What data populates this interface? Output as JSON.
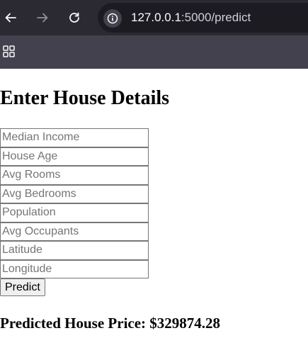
{
  "browser": {
    "url_host": "127.0.0.1",
    "url_rest": ":5000/predict"
  },
  "page": {
    "heading": "Enter House Details",
    "fields": [
      {
        "placeholder": "Median Income"
      },
      {
        "placeholder": "House Age"
      },
      {
        "placeholder": "Avg Rooms"
      },
      {
        "placeholder": "Avg Bedrooms"
      },
      {
        "placeholder": "Population"
      },
      {
        "placeholder": "Avg Occupants"
      },
      {
        "placeholder": "Latitude"
      },
      {
        "placeholder": "Longitude"
      }
    ],
    "submit_label": "Predict",
    "result_text": "Predicted House Price: $329874.28"
  },
  "icons": {
    "back": "back-arrow-icon",
    "forward": "forward-arrow-icon",
    "reload": "reload-icon",
    "info": "info-icon",
    "apps": "apps-grid-icon"
  },
  "colors": {
    "toolbar_bg": "#2b2a33",
    "urlbar_bg": "#1c1b22",
    "bookmarks_bg": "#42414d"
  }
}
